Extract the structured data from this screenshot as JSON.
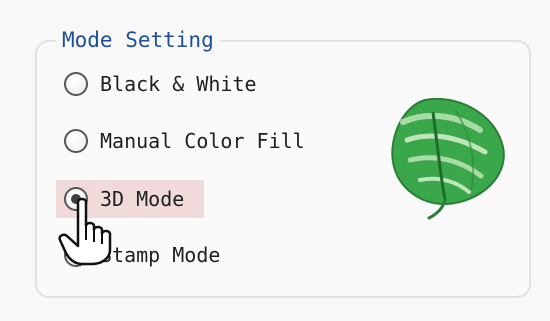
{
  "group": {
    "title": "Mode Setting"
  },
  "options": [
    {
      "label": "Black & White",
      "checked": false
    },
    {
      "label": "Manual Color Fill",
      "checked": false
    },
    {
      "label": "3D Mode",
      "checked": true
    },
    {
      "label": "Stamp Mode",
      "checked": false
    }
  ],
  "preview": {
    "icon": "leaf-icon"
  },
  "cursor": {
    "icon": "hand-pointer-icon"
  },
  "colors": {
    "legend": "#1e4f95",
    "selection_highlight": "#f0dada",
    "leaf_green": "#3aa84a"
  }
}
